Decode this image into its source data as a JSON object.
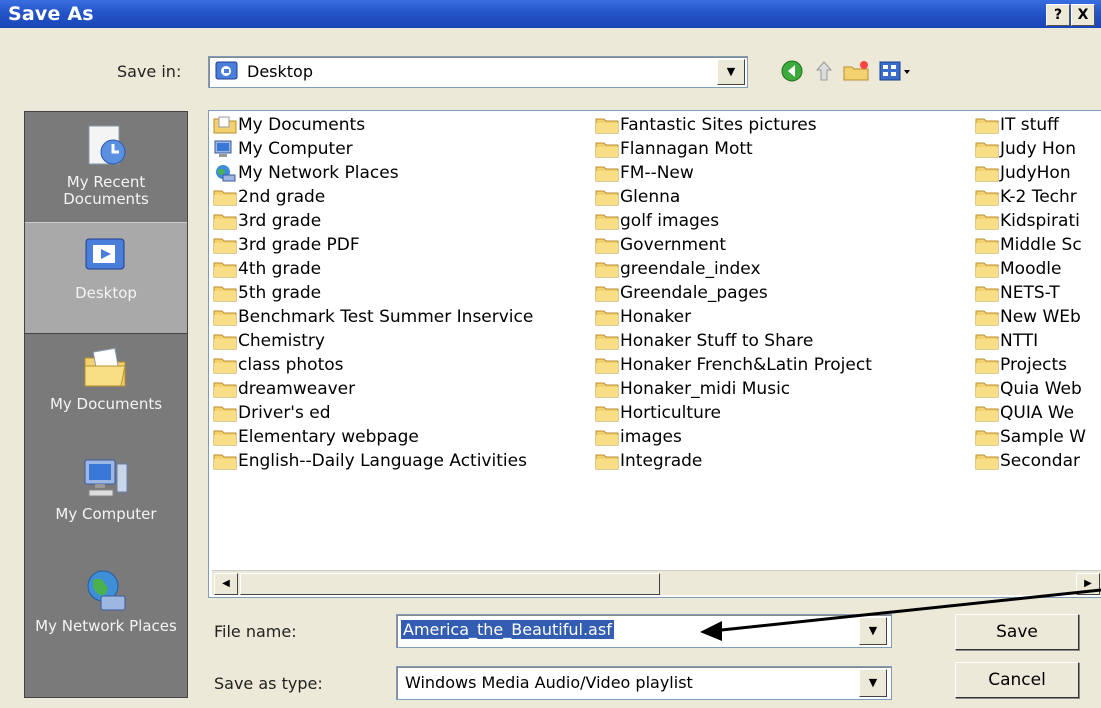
{
  "window": {
    "title": "Save As",
    "help_label": "?",
    "close_label": "X"
  },
  "save_in": {
    "label": "Save in:",
    "value": "Desktop"
  },
  "toolbar": {
    "back_icon": "back-arrow-icon",
    "up_icon": "up-folder-icon",
    "new_folder_icon": "new-folder-icon",
    "views_icon": "views-menu-icon"
  },
  "places": [
    {
      "label": "My Recent Documents",
      "icon": "recent-documents-icon"
    },
    {
      "label": "Desktop",
      "icon": "desktop-icon",
      "selected": true
    },
    {
      "label": "My Documents",
      "icon": "my-documents-icon"
    },
    {
      "label": "My Computer",
      "icon": "my-computer-icon"
    },
    {
      "label": "My Network Places",
      "icon": "network-places-icon"
    }
  ],
  "files": {
    "col1": [
      "My Documents",
      "My Computer",
      "My Network Places",
      "2nd grade",
      "3rd grade",
      "3rd grade PDF",
      "4th grade",
      "5th grade",
      "Benchmark Test Summer Inservice",
      "Chemistry",
      "class photos",
      "dreamweaver",
      "Driver's ed",
      "Elementary webpage",
      "English--Daily Language Activities"
    ],
    "col2": [
      "Fantastic Sites pictures",
      "Flannagan Mott",
      "FM--New",
      "Glenna",
      "golf images",
      "Government",
      "greendale_index",
      "Greendale_pages",
      "Honaker",
      "Honaker  Stuff to Share",
      "Honaker French&Latin Project",
      "Honaker_midi Music",
      "Horticulture",
      "images",
      "Integrade"
    ],
    "col3": [
      "IT stuff",
      "Judy Hon",
      "JudyHon",
      "K-2 Techr",
      "Kidspirati",
      "Middle Sc",
      "Moodle",
      "NETS-T",
      "New WEb",
      "NTTI",
      "Projects",
      "Quia Web",
      "QUIA We",
      "Sample W",
      "Secondar"
    ]
  },
  "file_name": {
    "label": "File name:",
    "value": "America_the_Beautiful.asf"
  },
  "save_type": {
    "label": "Save as type:",
    "value": "Windows Media Audio/Video playlist"
  },
  "buttons": {
    "save": "Save",
    "cancel": "Cancel"
  },
  "colors": {
    "titlebar": "#2454C8",
    "dialog_bg": "#ECE9D8",
    "places_bg": "#7A7A7A",
    "folder": "#F2D16E",
    "selection": "#335CB3"
  }
}
